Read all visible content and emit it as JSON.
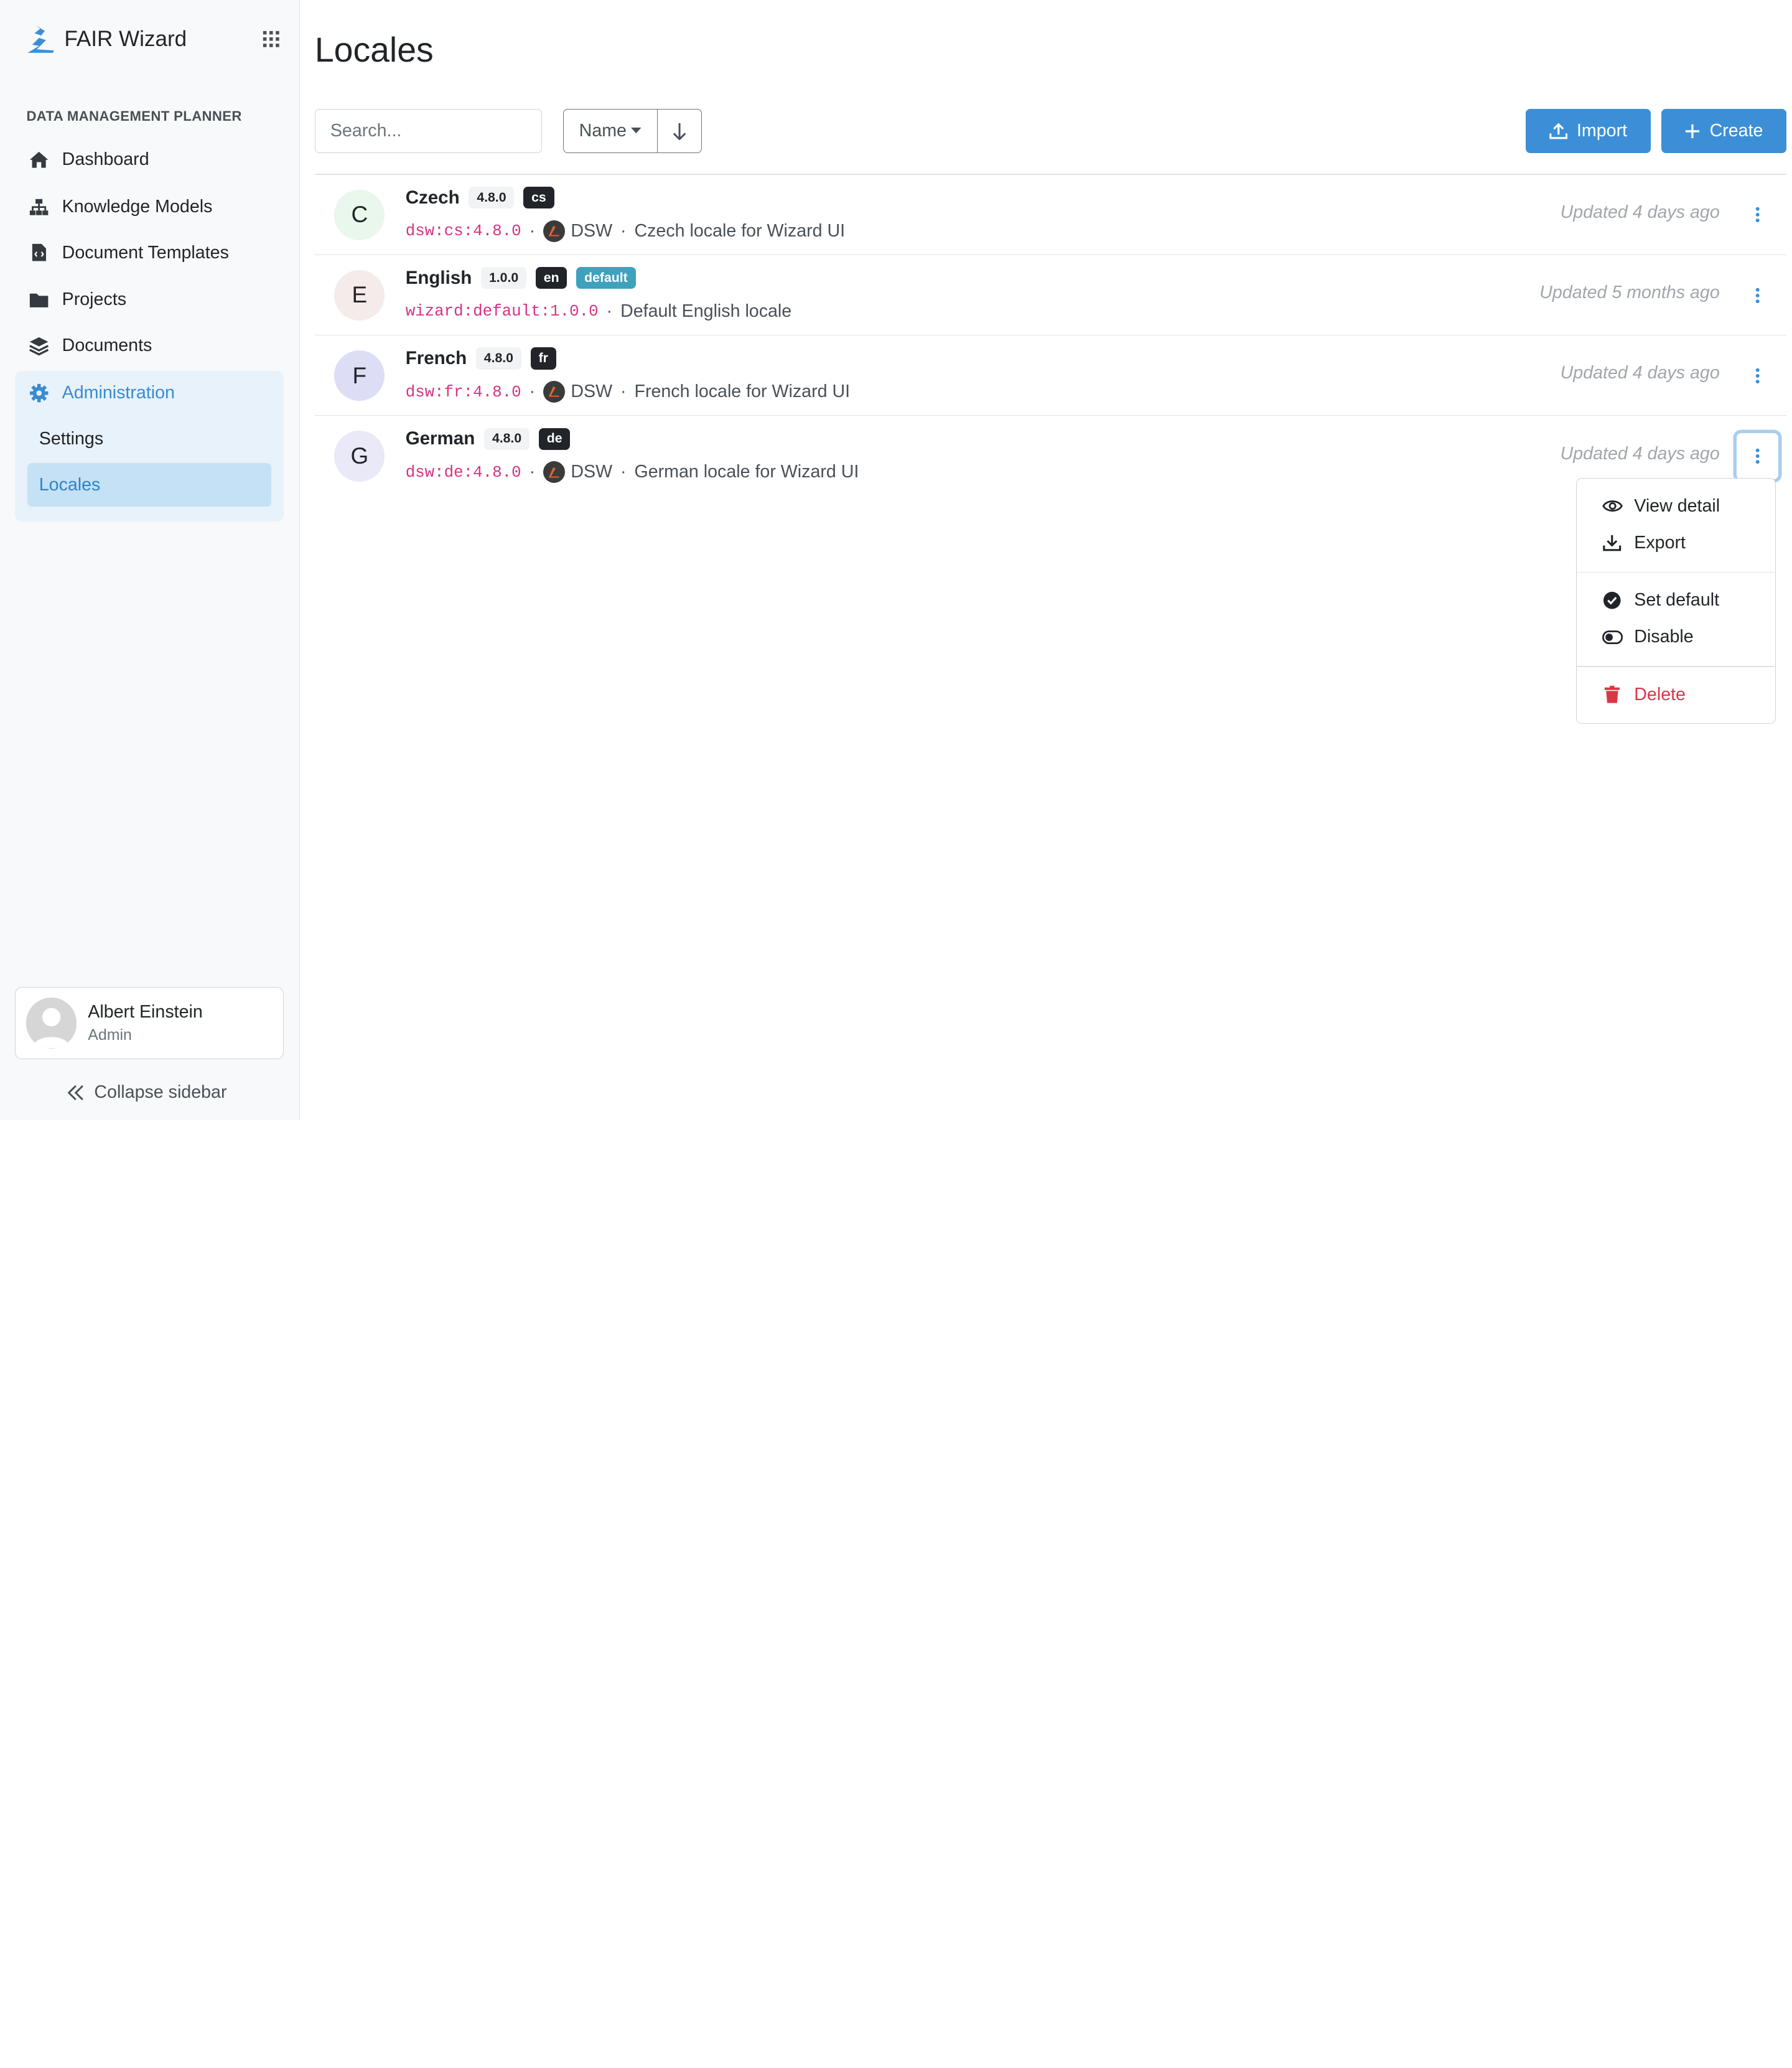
{
  "app": {
    "name": "FAIR Wizard"
  },
  "sidebar": {
    "section_title": "DATA MANAGEMENT PLANNER",
    "items": [
      {
        "label": "Dashboard",
        "icon": "home-icon"
      },
      {
        "label": "Knowledge Models",
        "icon": "sitemap-icon"
      },
      {
        "label": "Document Templates",
        "icon": "file-code-icon"
      },
      {
        "label": "Projects",
        "icon": "folder-icon"
      },
      {
        "label": "Documents",
        "icon": "layers-icon"
      }
    ],
    "admin": {
      "label": "Administration",
      "icon": "gear-icon",
      "subitems": [
        {
          "label": "Settings",
          "active": false
        },
        {
          "label": "Locales",
          "active": true
        }
      ]
    },
    "user": {
      "name": "Albert Einstein",
      "role": "Admin"
    },
    "collapse_label": "Collapse sidebar"
  },
  "page": {
    "title": "Locales",
    "search_placeholder": "Search...",
    "sort_label": "Name",
    "import_label": "Import",
    "create_label": "Create"
  },
  "locales": [
    {
      "letter": "C",
      "name": "Czech",
      "version": "4.8.0",
      "code": "cs",
      "default": false,
      "id": "dsw:cs:4.8.0",
      "org": "DSW",
      "description": "Czech locale for Wizard UI",
      "updated": "Updated 4 days ago",
      "color": "#e9f7ec"
    },
    {
      "letter": "E",
      "name": "English",
      "version": "1.0.0",
      "code": "en",
      "default": true,
      "default_label": "default",
      "id": "wizard:default:1.0.0",
      "org": "",
      "description": "Default English locale",
      "updated": "Updated 5 months ago",
      "color": "#f5ebeb"
    },
    {
      "letter": "F",
      "name": "French",
      "version": "4.8.0",
      "code": "fr",
      "default": false,
      "id": "dsw:fr:4.8.0",
      "org": "DSW",
      "description": "French locale for Wizard UI",
      "updated": "Updated 4 days ago",
      "color": "#ddddf6"
    },
    {
      "letter": "G",
      "name": "German",
      "version": "4.8.0",
      "code": "de",
      "default": false,
      "id": "dsw:de:4.8.0",
      "org": "DSW",
      "description": "German locale for Wizard UI",
      "updated": "Updated 4 days ago",
      "color": "#e9e9f7"
    }
  ],
  "dropdown": {
    "items": [
      {
        "label": "View detail",
        "icon": "eye-icon"
      },
      {
        "label": "Export",
        "icon": "download-icon"
      },
      {
        "label": "Set default",
        "icon": "check-circle-icon"
      },
      {
        "label": "Disable",
        "icon": "toggle-off-icon"
      },
      {
        "label": "Delete",
        "icon": "trash-icon"
      }
    ]
  },
  "colors": {
    "primary": "#3c8fd6",
    "active_bg": "#c5e1f5",
    "admin_bg": "#e8f2fa",
    "danger": "#dc3545",
    "code": "#d63384"
  }
}
